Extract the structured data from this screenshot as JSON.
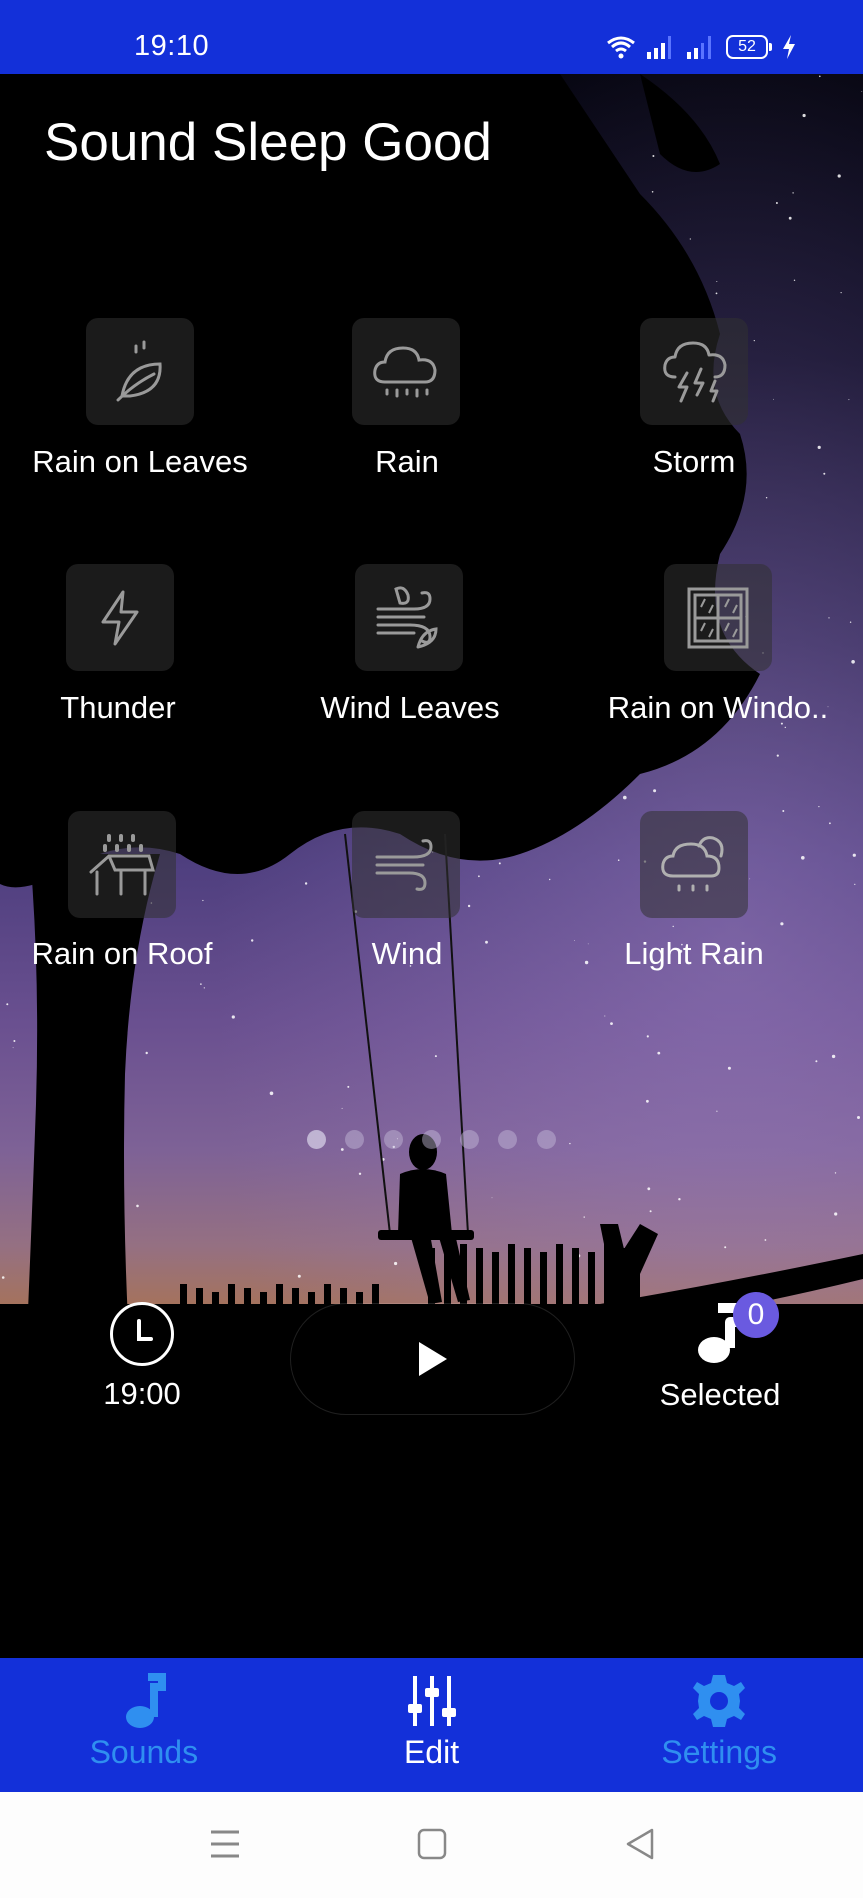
{
  "status_bar": {
    "time": "19:10",
    "battery": "52",
    "icons": [
      "wifi-icon",
      "signal-icon",
      "signal-icon",
      "battery-icon",
      "charging-icon"
    ]
  },
  "app": {
    "title": "Sound Sleep Good"
  },
  "sounds": [
    {
      "label": "Rain on Leaves",
      "icon": "leaf-rain-icon"
    },
    {
      "label": "Rain",
      "icon": "cloud-rain-icon"
    },
    {
      "label": "Storm",
      "icon": "storm-icon"
    },
    {
      "label": "Thunder",
      "icon": "lightning-icon"
    },
    {
      "label": "Wind Leaves",
      "icon": "wind-leaves-icon"
    },
    {
      "label": "Rain on Windo..",
      "icon": "window-rain-icon"
    },
    {
      "label": "Rain on Roof",
      "icon": "roof-rain-icon"
    },
    {
      "label": "Wind",
      "icon": "wind-icon"
    },
    {
      "label": "Light Rain",
      "icon": "light-rain-icon"
    }
  ],
  "pager": {
    "pages": 7,
    "current": 1
  },
  "player": {
    "timer": "19:00",
    "selected_label": "Selected",
    "selected_count": "0",
    "colors": {
      "badge": "#6a5ae0"
    }
  },
  "bottom_nav": {
    "items": [
      {
        "label": "Sounds",
        "icon": "music-note-icon",
        "active": false
      },
      {
        "label": "Edit",
        "icon": "sliders-icon",
        "active": true
      },
      {
        "label": "Settings",
        "icon": "gear-icon",
        "active": false
      }
    ],
    "colors": {
      "background": "#1330d9",
      "inactive": "#2f8ff0",
      "active": "#ffffff"
    }
  },
  "system_nav": {
    "buttons": [
      "menu-icon",
      "home-icon",
      "back-icon"
    ]
  }
}
